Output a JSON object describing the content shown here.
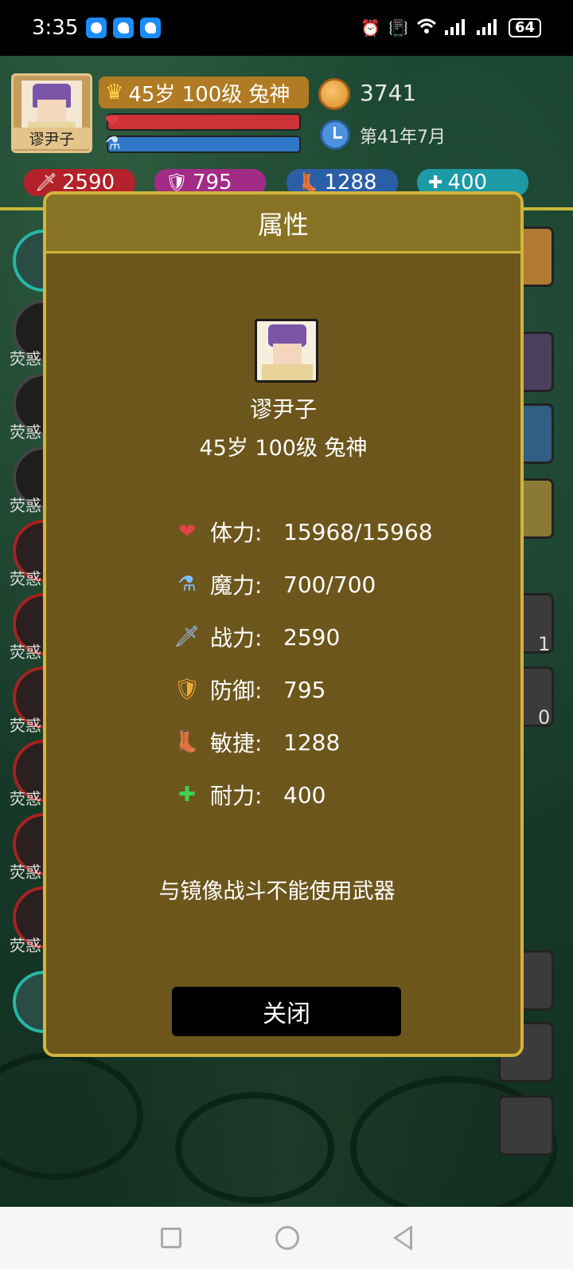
{
  "status_bar": {
    "time": "3:35",
    "battery": "64",
    "icons": [
      "message-icon",
      "qq-icon",
      "qq-icon",
      "alarm-icon",
      "vibrate-icon",
      "wifi-icon",
      "signal-icon",
      "signal-icon"
    ]
  },
  "header": {
    "avatar_name": "谬尹子",
    "title": "45岁 100级 兔神",
    "coins": "3741",
    "date": "第41年7月"
  },
  "top_stats": {
    "attack": "2590",
    "defense": "795",
    "agility": "1288",
    "stamina": "400"
  },
  "side_labels": [
    "荧惑",
    "荧惑",
    "荧惑",
    "荧惑",
    "荧惑",
    "荧惑",
    "荧惑",
    "荧惑",
    "荧惑"
  ],
  "side_counts": [
    "1",
    "0"
  ],
  "dialog": {
    "title": "属性",
    "name": "谬尹子",
    "subtitle": "45岁 100级 兔神",
    "stats": [
      {
        "icon": "heart-icon",
        "label": "体力:",
        "value": "15968/15968"
      },
      {
        "icon": "mana-potion-icon",
        "label": "魔力:",
        "value": "700/700"
      },
      {
        "icon": "sword-icon",
        "label": "战力:",
        "value": "2590"
      },
      {
        "icon": "shield-icon",
        "label": "防御:",
        "value": "795"
      },
      {
        "icon": "boot-icon",
        "label": "敏捷:",
        "value": "1288"
      },
      {
        "icon": "health-cross-icon",
        "label": "耐力:",
        "value": "400"
      }
    ],
    "notice": "与镜像战斗不能使用武器",
    "close_label": "关闭"
  }
}
